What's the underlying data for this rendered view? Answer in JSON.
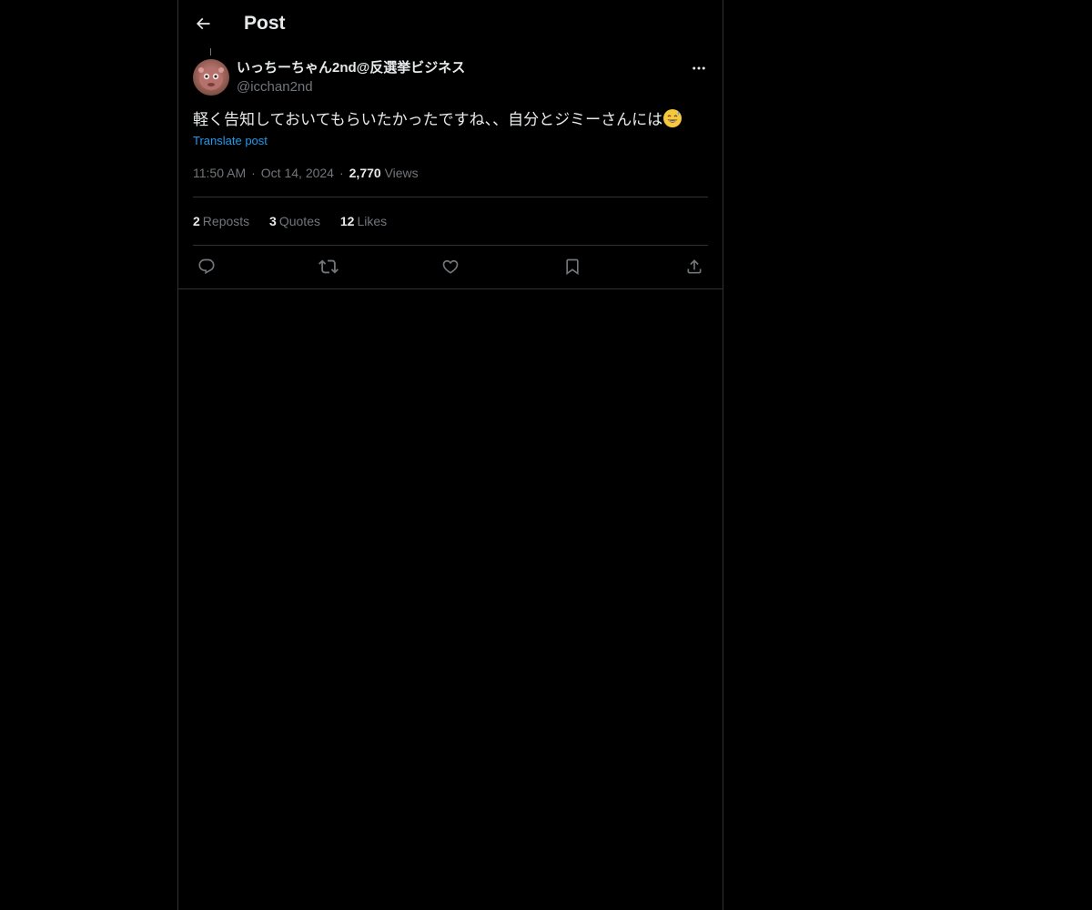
{
  "header": {
    "title": "Post",
    "back_icon": "arrow-left-icon"
  },
  "post": {
    "author": {
      "display_name": "いっちーちゃん2nd@反選挙ビジネス",
      "handle": "@icchan2nd",
      "avatar": "avatar-image"
    },
    "more_icon": "more-horizontal-icon",
    "text": "軽く告知しておいてもらいたかったですね、、自分とジミーさんには",
    "emoji": "grinning-sweat-emoji",
    "translate_label": "Translate post",
    "time": "11:50 AM",
    "date": "Oct 14, 2024",
    "views_count": "2,770",
    "views_label": "Views",
    "separator": "·"
  },
  "stats": {
    "reposts": {
      "count": "2",
      "label": "Reposts"
    },
    "quotes": {
      "count": "3",
      "label": "Quotes"
    },
    "likes": {
      "count": "12",
      "label": "Likes"
    }
  },
  "actions": [
    {
      "name": "reply",
      "icon": "reply-icon"
    },
    {
      "name": "repost",
      "icon": "repost-icon"
    },
    {
      "name": "like",
      "icon": "heart-icon"
    },
    {
      "name": "bookmark",
      "icon": "bookmark-icon"
    },
    {
      "name": "share",
      "icon": "share-icon"
    }
  ],
  "colors": {
    "background": "#000000",
    "text_primary": "#e7e9ea",
    "text_secondary": "#71767b",
    "link": "#1d9bf0",
    "border": "#2f3336"
  }
}
